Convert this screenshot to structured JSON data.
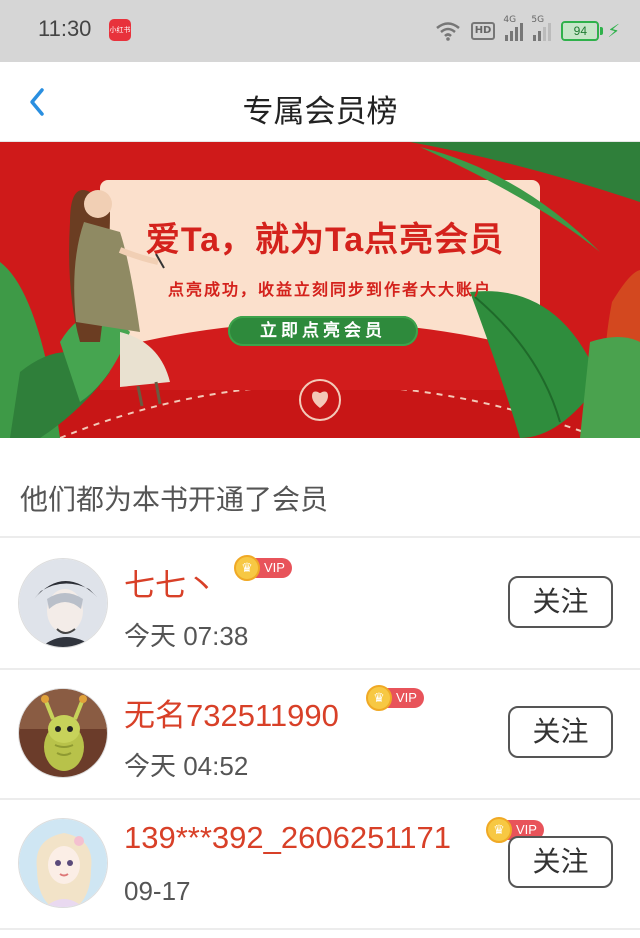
{
  "status_bar": {
    "time": "11:30",
    "app_badge": "小红书",
    "hd_label": "HD",
    "net1": "4G",
    "net2": "5G",
    "battery": "94",
    "battery_level": 0.94
  },
  "nav": {
    "title": "专属会员榜"
  },
  "banner": {
    "title": "爱Ta，就为Ta点亮会员",
    "subtitle": "点亮成功，收益立刻同步到作者大大账户",
    "button": "立即点亮会员"
  },
  "section_title": "他们都为本书开通了会员",
  "members": [
    {
      "name": "七七丶",
      "badge": "VIP",
      "time": "今天 07:38",
      "follow": "关注"
    },
    {
      "name": "无名732511990",
      "badge": "VIP",
      "time": "今天 04:52",
      "follow": "关注"
    },
    {
      "name": "139***392_2606251171",
      "badge": "VIP",
      "time": "09-17",
      "follow": "关注"
    }
  ],
  "colors": {
    "accent_red": "#d84028",
    "banner_red": "#cf1a1a",
    "button_green": "#2e8a3c",
    "back_blue": "#2a8fe0"
  }
}
